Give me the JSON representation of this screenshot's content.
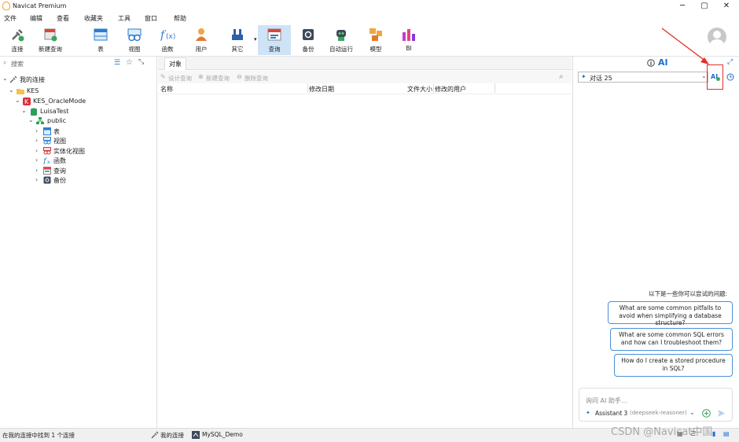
{
  "app": {
    "title": "Navicat Premium"
  },
  "menu": [
    "文件",
    "编辑",
    "查看",
    "收藏夹",
    "工具",
    "窗口",
    "帮助"
  ],
  "toolbar": [
    {
      "label": "连接",
      "icon": "connection-icon"
    },
    {
      "label": "新建查询",
      "icon": "new-query-icon"
    },
    {
      "label": "表",
      "icon": "table-icon"
    },
    {
      "label": "视图",
      "icon": "view-icon"
    },
    {
      "label": "函数",
      "icon": "function-icon"
    },
    {
      "label": "用户",
      "icon": "user-icon"
    },
    {
      "label": "其它",
      "icon": "other-icon"
    },
    {
      "label": "查询",
      "icon": "query-icon"
    },
    {
      "label": "备份",
      "icon": "backup-icon"
    },
    {
      "label": "自动运行",
      "icon": "automation-icon"
    },
    {
      "label": "模型",
      "icon": "model-icon"
    },
    {
      "label": "BI",
      "icon": "bi-icon"
    }
  ],
  "sidebar": {
    "search_placeholder": "搜索",
    "tree": {
      "root": "我的连接",
      "group": "KES",
      "connection": "KES_OracleMode",
      "database": "LuisaTest",
      "schema": "public",
      "items": [
        "表",
        "视图",
        "实体化视图",
        "函数",
        "查询",
        "备份"
      ]
    }
  },
  "center": {
    "tab": "对象",
    "actions": [
      "设计查询",
      "新建查询",
      "删除查询"
    ],
    "columns": [
      "名称",
      "修改日期",
      "文件大小",
      "修改的用户"
    ]
  },
  "ai_panel": {
    "header_ai": "AI",
    "conversation": "对话 25",
    "suggest_title": "以下是一些你可以尝试的问题:",
    "suggestions": [
      "What are some common pitfalls to avoid when simplifying a database structure?",
      "What are some common SQL errors and how can I troubleshoot them?",
      "How do I create a stored procedure in SQL?"
    ],
    "input_placeholder": "询问 AI 助手...",
    "assistant": "Assistant 3",
    "model": "(deepseek-reasoner)"
  },
  "status": {
    "left": "在我的连接中找到 1 个连接",
    "conn1": "我的连接",
    "conn2": "MySQL_Demo"
  },
  "watermark": "CSDN @Navicat中国",
  "colors": {
    "accent": "#1e6fd0",
    "highlight_box": "#e0302a",
    "arrow": "#e0302a",
    "active_tab": "#cfe3f7"
  }
}
